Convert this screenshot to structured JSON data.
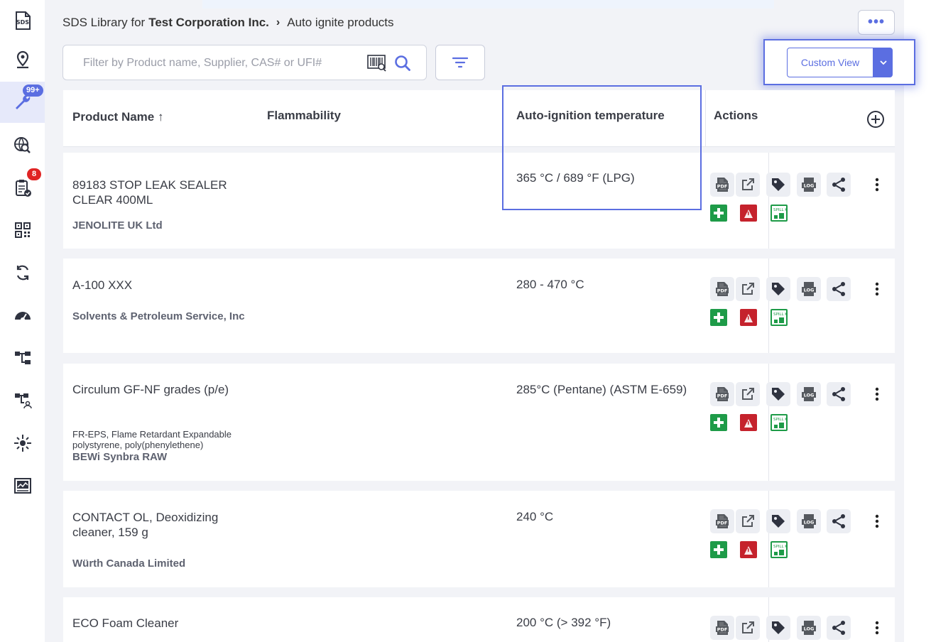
{
  "sidebar": {
    "items": [
      {
        "icon": "sds-icon",
        "badge": ""
      },
      {
        "icon": "location-pin-icon",
        "badge": ""
      },
      {
        "icon": "wrench-icon",
        "badge": "99+",
        "active": true
      },
      {
        "icon": "globe-search-icon",
        "badge": ""
      },
      {
        "icon": "clipboard-check-icon",
        "badge": "8"
      },
      {
        "icon": "qr-code-icon",
        "badge": ""
      },
      {
        "icon": "sync-icon",
        "badge": ""
      },
      {
        "icon": "gauge-icon",
        "badge": ""
      },
      {
        "icon": "hierarchy-icon",
        "badge": ""
      },
      {
        "icon": "hierarchy-user-icon",
        "badge": ""
      },
      {
        "icon": "sun-icon",
        "badge": ""
      },
      {
        "icon": "report-chart-icon",
        "badge": ""
      }
    ],
    "badge_wrench": "99+",
    "badge_clipboard": "8"
  },
  "breadcrumb": {
    "prefix": "SDS Library for",
    "company": "Test Corporation Inc.",
    "current": "Auto ignite products"
  },
  "more_button": {
    "label": "•••"
  },
  "search": {
    "placeholder": "Filter by Product name, Supplier, CAS# or UFI#",
    "value": ""
  },
  "custom_view": {
    "label": "Custom View"
  },
  "table": {
    "headers": {
      "product_name": "Product Name",
      "sort_arrow": "↑",
      "flammability": "Flammability",
      "auto_ignition": "Auto-ignition temperature",
      "actions": "Actions"
    },
    "rows": [
      {
        "name": "89183 STOP LEAK SEALER CLEAR 400ML",
        "description": "",
        "supplier": "JENOLITE UK Ltd",
        "flammability": "",
        "temperature": "365 °C / 689 °F (LPG)"
      },
      {
        "name": "A-100 XXX",
        "description": "",
        "supplier": "Solvents & Petroleum Service, Inc",
        "flammability": "",
        "temperature": "280 - 470 °C"
      },
      {
        "name": "Circulum GF-NF grades (p/e)",
        "description": "FR-EPS, Flame Retardant Expandable polystyrene, poly(phenylethene)",
        "supplier": "BEWi Synbra RAW",
        "flammability": "",
        "temperature": "285°C (Pentane) (ASTM E-659)"
      },
      {
        "name": "CONTACT OL, Deoxidizing cleaner, 159 g",
        "description": "",
        "supplier": "Würth Canada Limited",
        "flammability": "",
        "temperature": "240 °C"
      },
      {
        "name": "ECO Foam Cleaner",
        "description": "",
        "supplier": "",
        "flammability": "",
        "temperature": "200 °C (> 392 °F)"
      }
    ]
  },
  "action_icons": {
    "pdf": "PDF",
    "log": "LOG",
    "spill": "SPILL KIT"
  },
  "colors": {
    "accent": "#5b6ee1",
    "badge_red": "#e02424",
    "first_aid_green": "#1e9b48",
    "fire_red": "#c5222c"
  }
}
